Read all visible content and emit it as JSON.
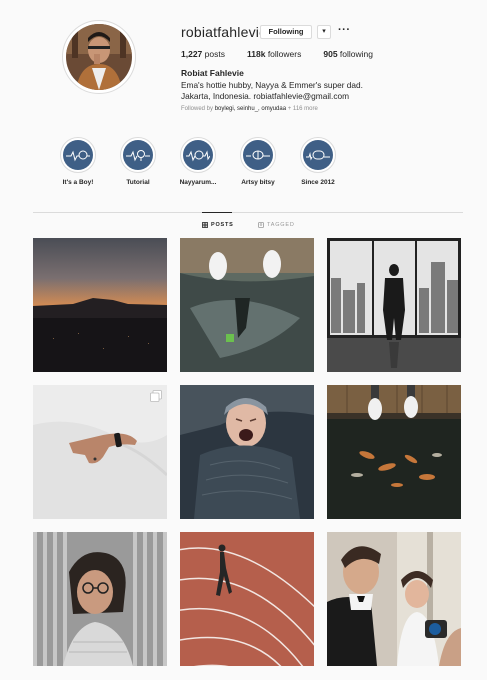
{
  "profile": {
    "username": "robiatfahlevie",
    "follow_label": "Following",
    "dropdown_glyph": "▾",
    "more_glyph": "···",
    "posts_count": "1,227",
    "posts_label": "posts",
    "followers_count": "118k",
    "followers_label": "followers",
    "following_count": "905",
    "following_label": "following",
    "full_name": "Robiat Fahlevie",
    "bio_line1": "Ema's hottie hubby, Nayya & Emmer's super dad.",
    "bio_line2": "Jakarta, Indonesia. robiatfahlevie@gmail.com",
    "followed_by_prefix": "Followed by",
    "followed_by_users": "boylegi, seinhu_, omyudaa",
    "followed_by_more": "+ 116 more"
  },
  "highlights": [
    {
      "label": "It's a Boy!",
      "icon": "heartbeat-baby-icon"
    },
    {
      "label": "Tutorial",
      "icon": "heartbeat-bulb-icon"
    },
    {
      "label": "Nayyarum...",
      "icon": "heartbeat-girl-icon"
    },
    {
      "label": "Artsy bitsy",
      "icon": "heartbeat-brain-icon"
    },
    {
      "label": "Since 2012",
      "icon": "heartbeat-2012-icon"
    }
  ],
  "tabs": {
    "posts": "POSTS",
    "tagged": "TAGGED"
  },
  "colors": {
    "highlight_bg": "#3f5f86",
    "background": "#fafafa",
    "border": "#dbdbdb"
  },
  "posts": [
    {
      "subject": "sunset over city skyline"
    },
    {
      "subject": "feet above reflective water"
    },
    {
      "subject": "man silhouetted at window over city"
    },
    {
      "subject": "hand with bracelet on white sheets",
      "multi": true
    },
    {
      "subject": "crying baby wrapped in blanket"
    },
    {
      "subject": "white shoes above koi pond"
    },
    {
      "subject": "woman with glasses in striped light"
    },
    {
      "subject": "person lying on running track"
    },
    {
      "subject": "groom and bride with camera"
    }
  ]
}
